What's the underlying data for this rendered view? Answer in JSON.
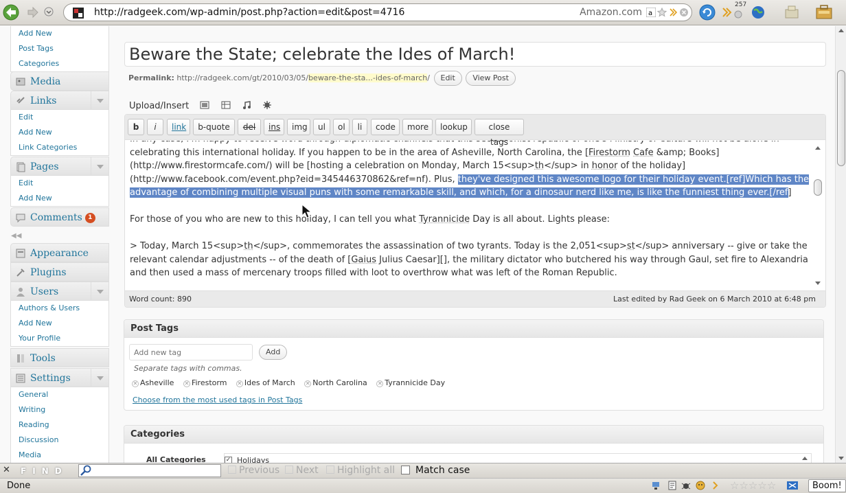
{
  "browser": {
    "url": "http://radgeek.com/wp-admin/post.php?action=edit&post=4716",
    "search_engine": "Amazon.com",
    "tab_count": "257"
  },
  "sidebar": {
    "posts_sub": [
      "Add New",
      "Post Tags",
      "Categories"
    ],
    "media": "Media",
    "links": "Links",
    "links_sub": [
      "Edit",
      "Add New",
      "Link Categories"
    ],
    "pages": "Pages",
    "pages_sub": [
      "Edit",
      "Add New"
    ],
    "comments": "Comments",
    "comments_count": "1",
    "appearance": "Appearance",
    "plugins": "Plugins",
    "users": "Users",
    "users_sub": [
      "Authors & Users",
      "Add New",
      "Your Profile"
    ],
    "tools": "Tools",
    "settings": "Settings",
    "settings_sub": [
      "General",
      "Writing",
      "Reading",
      "Discussion",
      "Media"
    ]
  },
  "post": {
    "title": "Beware the State; celebrate the Ides of March!",
    "permalink_label": "Permalink:",
    "permalink_base": "http://radgeek.com/gt/2010/03/05/",
    "permalink_slug": "beware-the-sta...-ides-of-march",
    "permalink_tail": "/",
    "edit_btn": "Edit",
    "view_btn": "View Post",
    "upload_label": "Upload/Insert"
  },
  "quicktags": [
    "b",
    "i",
    "link",
    "b-quote",
    "del",
    "ins",
    "img",
    "ul",
    "ol",
    "li",
    "code",
    "more",
    "lookup",
    "close tags"
  ],
  "editor": {
    "p1_a": "In any case, I'm happy to receive word through diplomatic channels that this secessionist republic of one's Ministry of Culture will not be alone in celebrating this international holiday. If you happen to be in the area of Asheville, North Carolina, the [",
    "p1_firestorm": "Firestorm",
    "p1_b": " ",
    "p1_cafe": "Cafe",
    "p1_c": " &amp; Books](http://www.firestormcafe.com/) will be [hosting a celebration on Monday, March 15<sup>",
    "p1_th": "th",
    "p1_d": "</sup> in ",
    "p1_honor": "honor",
    "p1_e": " of the holiday](http://www.facebook.com/event.php?eid=345446370862&ref=nf). Plus, ",
    "p1_selected": "they've designed this awesome logo for their holiday event.[ref]Which has the advantage of combining multiple visual puns with some remarkable skill, and which, for a dinosaur nerd like me, is like the funniest thing ever.[/ref",
    "p1_f": "]",
    "p2_a": "For those of you who are new to this holiday, I can tell you what ",
    "p2_tyr": "Tyrannicide",
    "p2_b": " Day is all about. Lights please:",
    "p3_a": " > Today, March 15<sup>",
    "p3_th": "th",
    "p3_b": "</sup>, commemorates the assassination of two tyrants. Today is the 2,051<sup>",
    "p3_st": "st",
    "p3_c": "</sup> anniversary -- give or take the relevant calendar adjustments -- of the death of [",
    "p3_gaius": "Gaius",
    "p3_d": " Julius Caesar][], the military dictator who butchered his way through Gaul, set fire to Alexandria and then used a mass of mercenary troops filled with loot to overthrow what was left of the Roman Republic.",
    "word_count": "Word count: 890",
    "last_edited": "Last edited by Rad Geek on 6 March 2010 at 6:48 pm"
  },
  "tags_box": {
    "title": "Post Tags",
    "placeholder": "Add new tag",
    "add_btn": "Add",
    "hint": "Separate tags with commas.",
    "tags": [
      "Asheville",
      "Firestorm",
      "Ides of March",
      "North Carolina",
      "Tyrannicide Day"
    ],
    "cloud_link": "Choose from the most used tags in Post Tags"
  },
  "categories_box": {
    "title": "Categories",
    "tab_all": "All Categories",
    "first_cat": "Holidays"
  },
  "find_bar": {
    "label": "FIND",
    "previous": "Previous",
    "next": "Next",
    "highlight": "Highlight all",
    "match_case": "Match case"
  },
  "status": {
    "text": "Done",
    "boom": "Boom!"
  },
  "colors": {
    "wp_link": "#21759b",
    "selection": "#5f86c6",
    "badge": "#d54e21"
  }
}
